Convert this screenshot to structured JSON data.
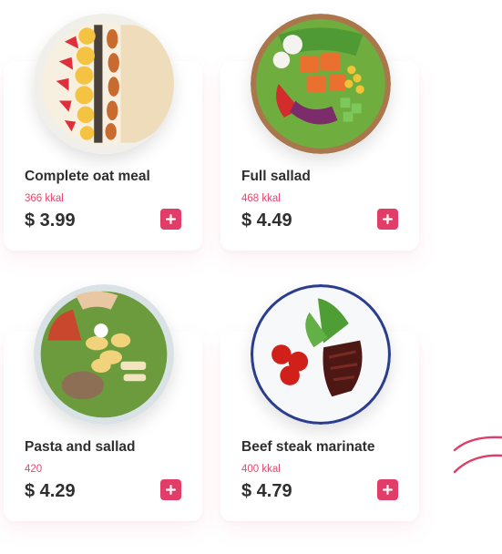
{
  "colors": {
    "accent": "#e23c68",
    "kcal": "#e14a6e",
    "text": "#2f2f2f"
  },
  "menu": {
    "items": [
      {
        "title": "Complete oat meal",
        "kcal": "366 kkal",
        "price": "$ 3.99",
        "image_icon": "oat-meal-bowl"
      },
      {
        "title": "Full sallad",
        "kcal": "468 kkal",
        "price": "$ 4.49",
        "image_icon": "salad-bowl"
      },
      {
        "title": "Pasta and sallad",
        "kcal": "420",
        "price": "$ 4.29",
        "image_icon": "pasta-bowl"
      },
      {
        "title": "Beef steak marinate",
        "kcal": "400 kkal",
        "price": "$ 4.79",
        "image_icon": "steak-plate"
      }
    ],
    "add_icon": "plus-icon"
  }
}
